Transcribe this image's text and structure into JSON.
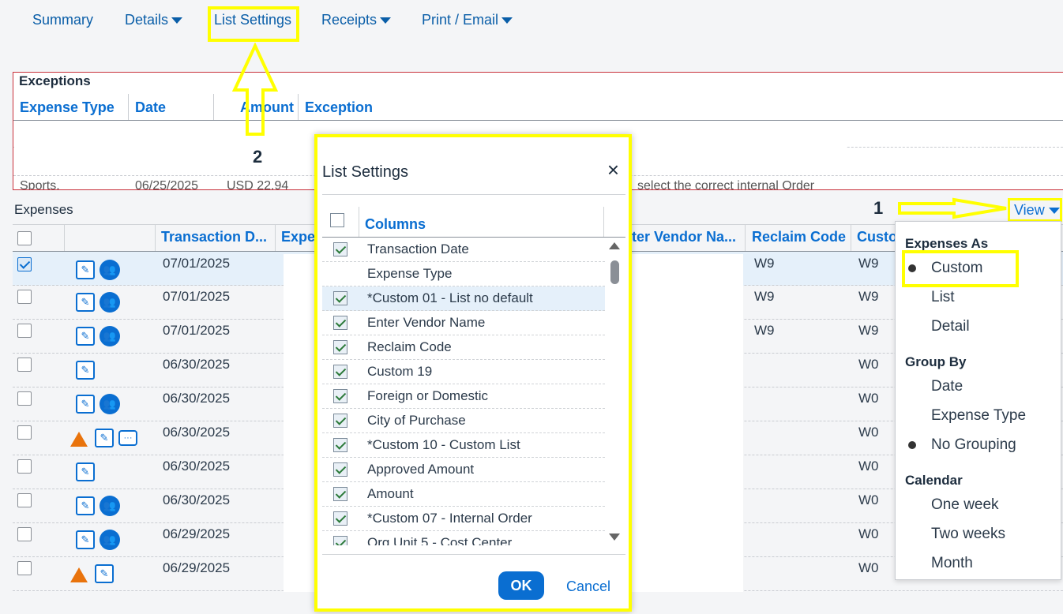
{
  "nav": {
    "summary": "Summary",
    "details": "Details",
    "list_settings": "List Settings",
    "receipts": "Receipts",
    "print_email": "Print / Email"
  },
  "exceptions": {
    "title": "Exceptions",
    "columns": [
      "Expense Type",
      "Date",
      "Amount",
      "Exception"
    ],
    "partial_row": [
      "Sports.",
      "06/25/2025",
      "USD 22.94",
      "select the correct internal Order"
    ]
  },
  "annotations": {
    "step1": "1",
    "step2": "2"
  },
  "expenses": {
    "title": "Expenses",
    "columns": [
      "Transaction D...",
      "Expe",
      "ter Vendor Na...",
      "Reclaim Code",
      "Custo"
    ],
    "rows": [
      {
        "date": "07/01/2025",
        "reclaim": "W9",
        "custom": "W9",
        "selected": true
      },
      {
        "date": "07/01/2025",
        "reclaim": "W9",
        "custom": "W9"
      },
      {
        "date": "07/01/2025",
        "reclaim": "W9",
        "custom": "W9"
      },
      {
        "date": "06/30/2025",
        "reclaim": "",
        "custom": "W0"
      },
      {
        "date": "06/30/2025",
        "reclaim": "",
        "custom": "W0"
      },
      {
        "date": "06/30/2025",
        "reclaim": "",
        "custom": "W0"
      },
      {
        "date": "06/30/2025",
        "reclaim": "",
        "custom": "W0"
      },
      {
        "date": "06/30/2025",
        "reclaim": "",
        "custom": "W0"
      },
      {
        "date": "06/29/2025",
        "reclaim": "",
        "custom": "W0"
      },
      {
        "date": "06/29/2025",
        "reclaim": "",
        "custom": "W0"
      }
    ]
  },
  "dialog": {
    "title": "List Settings",
    "close": "×",
    "columns_header": "Columns",
    "items": [
      {
        "label": "Transaction Date",
        "checked": true
      },
      {
        "label": "Expense Type",
        "checked": false,
        "nocb": true
      },
      {
        "label": "*Custom 01 - List no default",
        "checked": true
      },
      {
        "label": "Enter Vendor Name",
        "checked": true
      },
      {
        "label": "Reclaim Code",
        "checked": true
      },
      {
        "label": "Custom 19",
        "checked": true
      },
      {
        "label": "Foreign or Domestic",
        "checked": true
      },
      {
        "label": "City of Purchase",
        "checked": true
      },
      {
        "label": "*Custom 10 - Custom List",
        "checked": true
      },
      {
        "label": "Approved Amount",
        "checked": true
      },
      {
        "label": "Amount",
        "checked": true
      },
      {
        "label": "*Custom 07 - Internal Order",
        "checked": true
      },
      {
        "label": "Org Unit 5 - Cost Center",
        "checked": true
      }
    ],
    "ok": "OK",
    "cancel": "Cancel"
  },
  "view": {
    "button": "View",
    "expenses_as": "Expenses As",
    "custom": "Custom",
    "list": "List",
    "detail": "Detail",
    "group_by": "Group By",
    "date": "Date",
    "expense_type": "Expense Type",
    "no_grouping": "No Grouping",
    "calendar": "Calendar",
    "one_week": "One week",
    "two_weeks": "Two weeks",
    "month": "Month"
  },
  "colors": {
    "accent": "#0a6ed1",
    "highlight": "#ffff00",
    "warning": "#e9730c",
    "exception_border": "#c8303a"
  }
}
